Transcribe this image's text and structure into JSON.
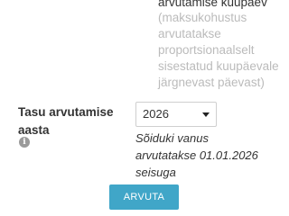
{
  "calc_date": {
    "title": "arvutamise kuupäev",
    "hint_lines": [
      "(maksukohustus",
      "arvutatakse",
      "proportsionaalselt",
      "sisestatud kuupäevale",
      "järgnevast päevast)"
    ]
  },
  "tax_year": {
    "label": "Tasu arvutamise aasta",
    "info_icon": "info-icon",
    "selected": "2026",
    "note_lines": [
      "Sõiduki vanus",
      "arvutatakse 01.01.2026",
      "seisuga"
    ]
  },
  "actions": {
    "calculate_label": "ARVUTA"
  },
  "colors": {
    "button": "#40a6c8",
    "hint_text": "#bbbbbb",
    "text": "#333333"
  }
}
